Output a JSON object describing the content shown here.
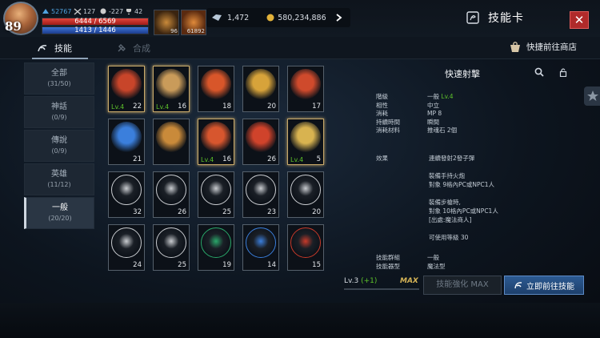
{
  "player": {
    "level": "89",
    "power": "52767",
    "stat_a": "127",
    "stat_b": "-227",
    "stat_c": "42",
    "hp": "6444 / 6569",
    "mp": "1413 / 1446"
  },
  "slots": [
    {
      "count": "96"
    },
    {
      "count": "61892"
    }
  ],
  "currency": {
    "crystal": "1,472",
    "gold": "580,234,886"
  },
  "header": {
    "title": "技能卡",
    "close": "✕"
  },
  "tabs": {
    "skill": "技能",
    "compose": "合成",
    "shop": "快捷前往商店"
  },
  "categories": [
    {
      "name": "全部",
      "count": "(31/50)"
    },
    {
      "name": "神話",
      "count": "(0/9)"
    },
    {
      "name": "傳說",
      "count": "(0/9)"
    },
    {
      "name": "英雄",
      "count": "(11/12)"
    },
    {
      "name": "一般",
      "count": "(20/20)"
    }
  ],
  "cards": [
    {
      "lv": "Lv.4",
      "count": "22",
      "icon": "cannon-icon",
      "color": "#c8452a"
    },
    {
      "lv": "Lv.4",
      "count": "16",
      "icon": "shield-swirl-icon",
      "color": "#c99b5a"
    },
    {
      "lv": "",
      "count": "18",
      "icon": "explosion-icon",
      "color": "#d8562a"
    },
    {
      "lv": "",
      "count": "20",
      "icon": "heal-plus-icon",
      "color": "#d7a33a"
    },
    {
      "lv": "",
      "count": "17",
      "icon": "power-up-icon",
      "color": "#cf4a2c"
    },
    {
      "lv": "",
      "count": "21",
      "icon": "water-wave-icon",
      "color": "#3b7fdc"
    },
    {
      "lv": "",
      "count": "",
      "icon": "armor-icon",
      "color": "#c98a3a"
    },
    {
      "lv": "Lv.4",
      "count": "16",
      "icon": "armor-ring-icon",
      "color": "#d7562e"
    },
    {
      "lv": "",
      "count": "26",
      "icon": "speed-up-icon",
      "color": "#d0432b"
    },
    {
      "lv": "Lv.4",
      "count": "5",
      "icon": "rapid-shot-icon",
      "color": "#d8b350"
    },
    {
      "lv": "",
      "count": "32",
      "icon": "shield-icon",
      "color": "#c9ccd0"
    },
    {
      "lv": "",
      "count": "26",
      "icon": "lightning-icon",
      "color": "#c9ccd0"
    },
    {
      "lv": "",
      "count": "25",
      "icon": "arc-arrow-icon",
      "color": "#c9ccd0"
    },
    {
      "lv": "",
      "count": "23",
      "icon": "burst-icon",
      "color": "#c9ccd0"
    },
    {
      "lv": "",
      "count": "20",
      "icon": "weight-icon",
      "color": "#c9ccd0"
    },
    {
      "lv": "",
      "count": "24",
      "icon": "eye-icon",
      "color": "#c9ccd0"
    },
    {
      "lv": "",
      "count": "25",
      "icon": "spiky-icon",
      "color": "#c9ccd0"
    },
    {
      "lv": "",
      "count": "19",
      "icon": "sword-icon",
      "color": "#2aa86a"
    },
    {
      "lv": "",
      "count": "14",
      "icon": "blue-heal-icon",
      "color": "#3b7fdc"
    },
    {
      "lv": "",
      "count": "15",
      "icon": "star-book-icon",
      "color": "#c83a2a"
    }
  ],
  "panel": {
    "title": "快速射擊",
    "rows": [
      {
        "k": "階級",
        "v": "一般 ",
        "g": "Lv.4"
      },
      {
        "k": "相性",
        "v": "中立",
        "g": ""
      },
      {
        "k": "消耗",
        "v": "MP 8",
        "g": ""
      },
      {
        "k": "持續時間",
        "v": "瞬間",
        "g": ""
      },
      {
        "k": "消耗材料",
        "v": "推魂石 2個",
        "g": ""
      }
    ],
    "effect_label": "效果",
    "effect_lines": [
      "連續發射2發子彈",
      "",
      "裝備手持火炮",
      "對象 9格內PC或NPC1人",
      "",
      "裝備步槍時,",
      "對象 10格內PC或NPC1人",
      "[出處:魔法商人]",
      "",
      "可使用等級 30"
    ],
    "tail_rows": [
      {
        "k": "技能群組",
        "v": "一般"
      },
      {
        "k": "技能器型",
        "v": "魔法型"
      }
    ]
  },
  "level_bar": {
    "lv": "Lv.3",
    "plus": "(+1)",
    "max": "MAX"
  },
  "buttons": {
    "upgrade": "技能強化 MAX",
    "go": "立即前往技能"
  }
}
